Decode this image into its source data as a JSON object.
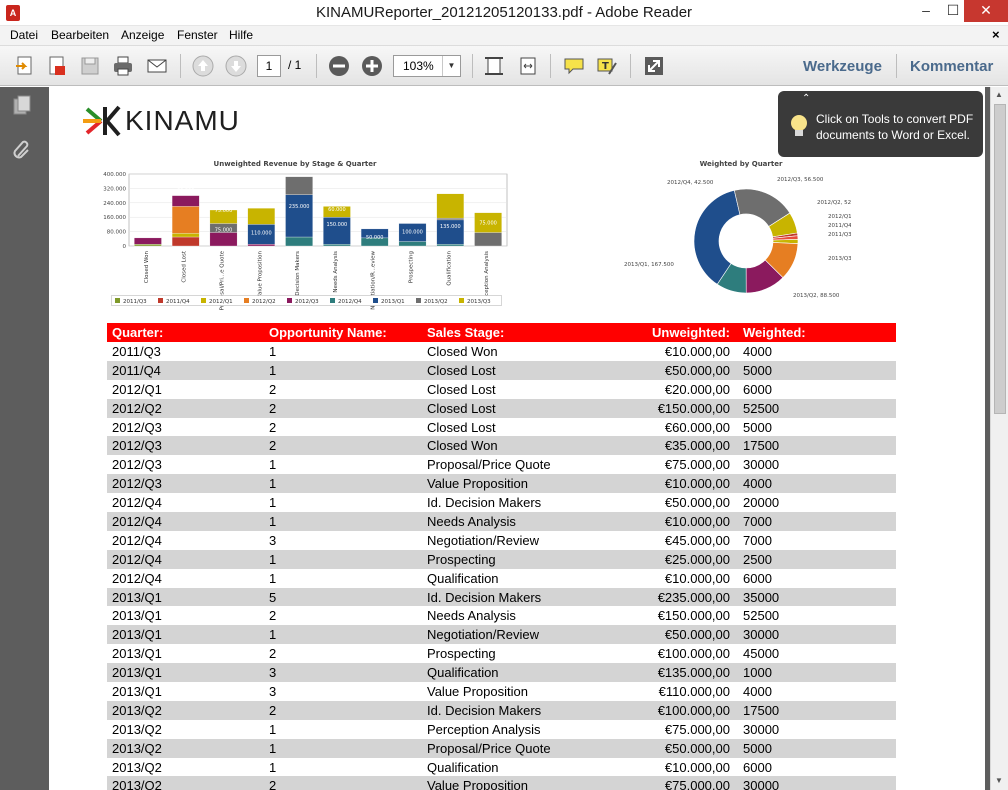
{
  "window": {
    "title": "KINAMUReporter_20121205120133.pdf - Adobe Reader",
    "min_glyph": "–",
    "max_glyph": "☐",
    "close_glyph": "✕"
  },
  "menu": {
    "items": [
      "Datei",
      "Bearbeiten",
      "Anzeige",
      "Fenster",
      "Hilfe"
    ],
    "close_glyph": "×"
  },
  "toolbar": {
    "page_current": "1",
    "page_total": "/ 1",
    "zoom": "103%",
    "tools_label": "Werkzeuge",
    "comment_label": "Kommentar"
  },
  "tooltip": {
    "text": "Click on Tools to convert PDF documents to Word or Excel."
  },
  "logo": {
    "text": "KINAMU"
  },
  "bar_chart": {
    "title": "Unweighted Revenue by Stage & Quarter",
    "y_ticks": [
      "400.000",
      "320.000",
      "240.000",
      "160.000",
      "80.000",
      "0"
    ],
    "categories": [
      "Closed Won",
      "Closed Lost",
      "Proposal/Pri...e Quote",
      "Value Proposition",
      "Id. Decision Makers",
      "Needs Analysis",
      "Negotiation/R...eview",
      "Prospecting",
      "Qualification",
      "Perception Analysis"
    ],
    "legend": [
      "2011/Q3",
      "2011/Q4",
      "2012/Q1",
      "2012/Q2",
      "2012/Q3",
      "2012/Q4",
      "2013/Q1",
      "2013/Q2",
      "2013/Q3"
    ],
    "segment_labels": {
      "closed_lost_top": "60.000",
      "proposal_top": "75.000",
      "proposal_bottom": "75.000",
      "value_mid": "110.000",
      "id_mid": "235.000",
      "needs_top": "60.000",
      "needs_mid": "150.000",
      "negotiation": "50.000",
      "prospecting": "100.000",
      "qualification": "135.000",
      "perception": "75.000"
    }
  },
  "donut_chart": {
    "title": "Weighted by Quarter",
    "labels": {
      "q4_2012": "2012/Q4, 42.500",
      "q3_2012": "2012/Q3, 56.500",
      "q2_2012": "2012/Q2, 52.500",
      "q1_2012": "2012/Q1, 6.000",
      "q4_2011": "2011/Q4, 5.000",
      "q3_2011": "2011/Q3, 4.000",
      "q3_2013": "2013/Q3, 29.500",
      "q2_2013": "2013/Q2, 88.500",
      "q1_2013": "2013/Q1, 167.500"
    }
  },
  "chart_data": [
    {
      "type": "bar",
      "title": "Unweighted Revenue by Stage & Quarter",
      "stacked": true,
      "categories": [
        "Closed Won",
        "Closed Lost",
        "Proposal/Price Quote",
        "Value Proposition",
        "Id. Decision Makers",
        "Needs Analysis",
        "Negotiation/Review",
        "Prospecting",
        "Qualification",
        "Perception Analysis"
      ],
      "ylim": [
        0,
        400000
      ],
      "series": [
        {
          "name": "2011/Q3",
          "color": "#7f9a2a",
          "values": [
            10000,
            0,
            0,
            0,
            0,
            0,
            0,
            0,
            0,
            0
          ]
        },
        {
          "name": "2011/Q4",
          "color": "#c0392b",
          "values": [
            0,
            50000,
            0,
            0,
            0,
            0,
            0,
            0,
            0,
            0
          ]
        },
        {
          "name": "2012/Q1",
          "color": "#c8b400",
          "values": [
            0,
            20000,
            0,
            0,
            0,
            0,
            0,
            0,
            0,
            0
          ]
        },
        {
          "name": "2012/Q2",
          "color": "#e67e22",
          "values": [
            0,
            150000,
            0,
            0,
            0,
            0,
            0,
            0,
            0,
            0
          ]
        },
        {
          "name": "2012/Q3",
          "color": "#8b1a5e",
          "values": [
            35000,
            60000,
            75000,
            10000,
            0,
            0,
            0,
            0,
            0,
            0
          ]
        },
        {
          "name": "2012/Q4",
          "color": "#2e7d7d",
          "values": [
            0,
            0,
            0,
            0,
            50000,
            10000,
            45000,
            25000,
            10000,
            0
          ]
        },
        {
          "name": "2013/Q1",
          "color": "#1f4e8c",
          "values": [
            0,
            0,
            0,
            110000,
            235000,
            150000,
            50000,
            100000,
            135000,
            0
          ]
        },
        {
          "name": "2013/Q2",
          "color": "#6e6e6e",
          "values": [
            0,
            0,
            50000,
            0,
            100000,
            0,
            0,
            0,
            10000,
            75000
          ]
        },
        {
          "name": "2013/Q3",
          "color": "#c8b400",
          "values": [
            0,
            0,
            75000,
            90000,
            0,
            60000,
            0,
            0,
            135000,
            110000
          ]
        }
      ]
    },
    {
      "type": "pie",
      "title": "Weighted by Quarter",
      "donut": true,
      "categories": [
        "2011/Q3",
        "2011/Q4",
        "2012/Q1",
        "2012/Q2",
        "2012/Q3",
        "2012/Q4",
        "2013/Q1",
        "2013/Q2",
        "2013/Q3"
      ],
      "values": [
        4000,
        5000,
        6000,
        52500,
        56500,
        42500,
        167500,
        88500,
        29500
      ],
      "colors": [
        "#c0392b",
        "#e74c3c",
        "#c8b400",
        "#e67e22",
        "#8b1a5e",
        "#2e7d7d",
        "#1f4e8c",
        "#6e6e6e",
        "#c8b400"
      ]
    }
  ],
  "table": {
    "headers": [
      "Quarter:",
      "Opportunity Name:",
      "Sales Stage:",
      "Unweighted:",
      "Weighted:"
    ],
    "rows": [
      [
        "2011/Q3",
        "1",
        "Closed Won",
        "€10.000,00",
        "4000"
      ],
      [
        "2011/Q4",
        "1",
        "Closed Lost",
        "€50.000,00",
        "5000"
      ],
      [
        "2012/Q1",
        "2",
        "Closed Lost",
        "€20.000,00",
        "6000"
      ],
      [
        "2012/Q2",
        "2",
        "Closed Lost",
        "€150.000,00",
        "52500"
      ],
      [
        "2012/Q3",
        "2",
        "Closed Lost",
        "€60.000,00",
        "5000"
      ],
      [
        "2012/Q3",
        "2",
        "Closed Won",
        "€35.000,00",
        "17500"
      ],
      [
        "2012/Q3",
        "1",
        "Proposal/Price Quote",
        "€75.000,00",
        "30000"
      ],
      [
        "2012/Q3",
        "1",
        "Value Proposition",
        "€10.000,00",
        "4000"
      ],
      [
        "2012/Q4",
        "1",
        "Id. Decision Makers",
        "€50.000,00",
        "20000"
      ],
      [
        "2012/Q4",
        "1",
        "Needs Analysis",
        "€10.000,00",
        "7000"
      ],
      [
        "2012/Q4",
        "3",
        "Negotiation/Review",
        "€45.000,00",
        "7000"
      ],
      [
        "2012/Q4",
        "1",
        "Prospecting",
        "€25.000,00",
        "2500"
      ],
      [
        "2012/Q4",
        "1",
        "Qualification",
        "€10.000,00",
        "6000"
      ],
      [
        "2013/Q1",
        "5",
        "Id. Decision Makers",
        "€235.000,00",
        "35000"
      ],
      [
        "2013/Q1",
        "2",
        "Needs Analysis",
        "€150.000,00",
        "52500"
      ],
      [
        "2013/Q1",
        "1",
        "Negotiation/Review",
        "€50.000,00",
        "30000"
      ],
      [
        "2013/Q1",
        "2",
        "Prospecting",
        "€100.000,00",
        "45000"
      ],
      [
        "2013/Q1",
        "3",
        "Qualification",
        "€135.000,00",
        "1000"
      ],
      [
        "2013/Q1",
        "3",
        "Value Proposition",
        "€110.000,00",
        "4000"
      ],
      [
        "2013/Q2",
        "2",
        "Id. Decision Makers",
        "€100.000,00",
        "17500"
      ],
      [
        "2013/Q2",
        "1",
        "Perception Analysis",
        "€75.000,00",
        "30000"
      ],
      [
        "2013/Q2",
        "1",
        "Proposal/Price Quote",
        "€50.000,00",
        "5000"
      ],
      [
        "2013/Q2",
        "1",
        "Qualification",
        "€10.000,00",
        "6000"
      ],
      [
        "2013/Q2",
        "2",
        "Value Proposition",
        "€75.000,00",
        "30000"
      ]
    ]
  }
}
